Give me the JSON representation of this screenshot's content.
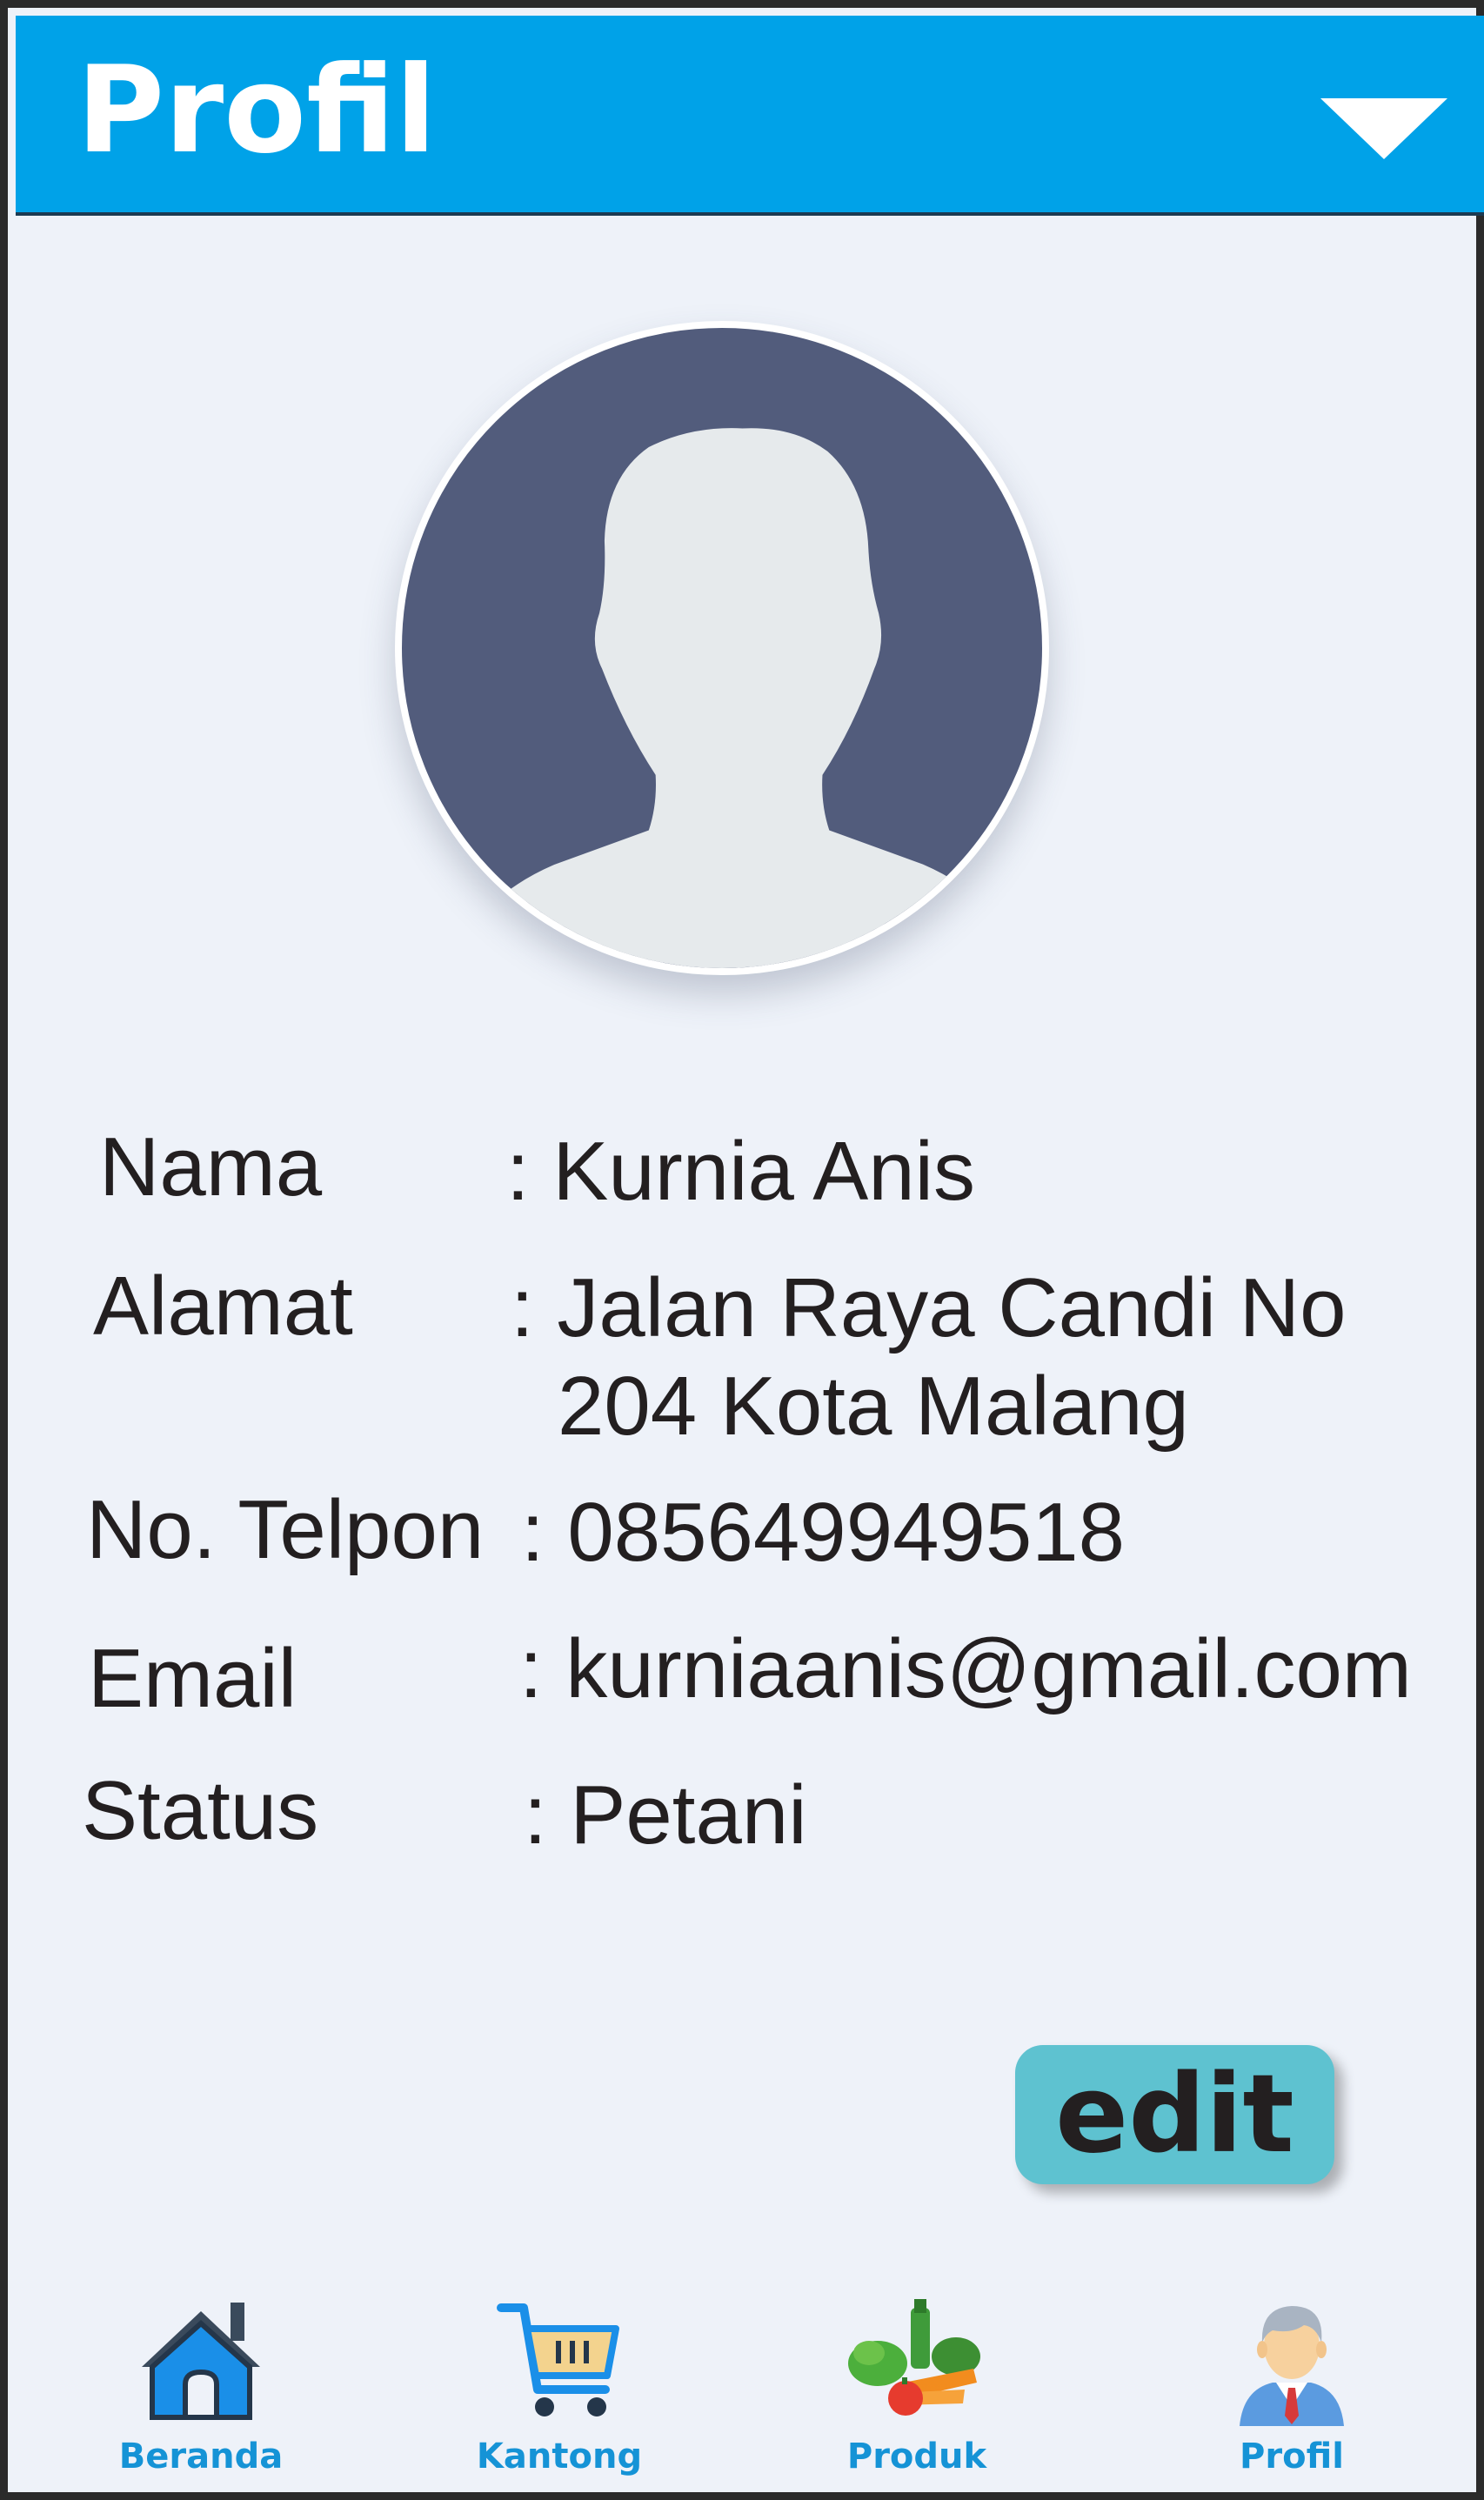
{
  "header": {
    "title": "Profil",
    "menu_icon": "chevron-down-icon"
  },
  "avatar": {
    "icon": "user-silhouette-icon"
  },
  "profile": {
    "nama_label": "Nama",
    "nama_value": ": Kurnia Anis",
    "alamat_label": "Alamat",
    "alamat_value_line1": ": Jalan Raya Candi No",
    "alamat_value_line2": "204 Kota Malang",
    "telpon_label": "No. Telpon",
    "telpon_value": ": 085649949518",
    "email_label": "Email",
    "email_value": ": kurniaanis@gmail.com",
    "status_label": "Status",
    "status_value": ": Petani"
  },
  "edit_button": {
    "label": "edit"
  },
  "bottom_nav": {
    "items": [
      {
        "label": "Beranda",
        "icon": "home-icon"
      },
      {
        "label": "Kantong",
        "icon": "cart-icon"
      },
      {
        "label": "Produk",
        "icon": "vegetables-icon"
      },
      {
        "label": "Profil",
        "icon": "profile-icon"
      }
    ]
  },
  "colors": {
    "header": "#00a2e8",
    "background": "#eef2f9",
    "avatar": "#525c7c",
    "edit_button": "#5ec2d0",
    "nav_label": "#1593d6"
  }
}
